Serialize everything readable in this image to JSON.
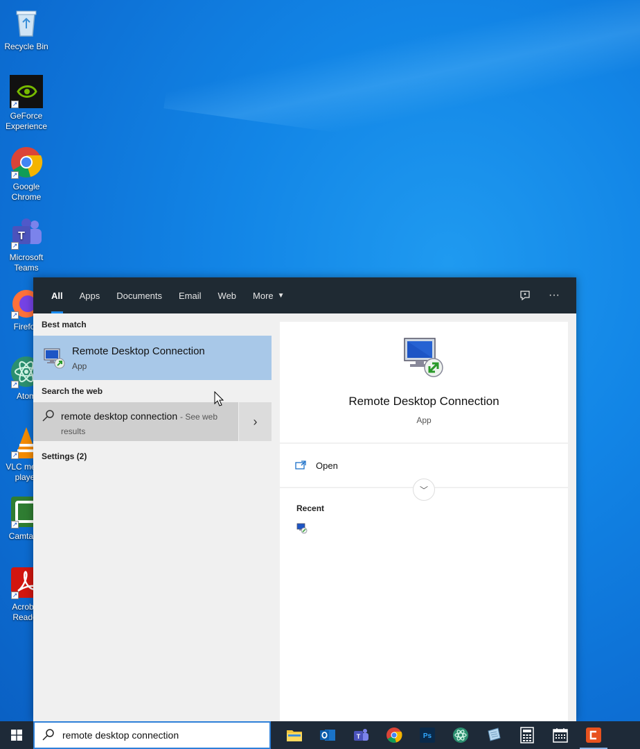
{
  "desktop": {
    "icons": [
      {
        "label": "Recycle Bin"
      },
      {
        "label": "GeForce Experience"
      },
      {
        "label": "Google Chrome"
      },
      {
        "label": "Microsoft Teams"
      },
      {
        "label": "Firefox"
      },
      {
        "label": "Atom"
      },
      {
        "label": "VLC media player"
      },
      {
        "label": "Camtasia"
      },
      {
        "label": "Acrobat Reader"
      }
    ]
  },
  "search_flyout": {
    "tabs": [
      "All",
      "Apps",
      "Documents",
      "Email",
      "Web",
      "More"
    ],
    "best_match_title": "Best match",
    "best_match": {
      "name": "Remote Desktop Connection",
      "type": "App"
    },
    "search_web_title": "Search the web",
    "web_result": {
      "query": "remote desktop connection",
      "hint": "- See web results"
    },
    "settings_title": "Settings (2)",
    "detail": {
      "name": "Remote Desktop Connection",
      "type": "App",
      "open_label": "Open",
      "recent_title": "Recent"
    }
  },
  "taskbar": {
    "search_value": "remote desktop connection",
    "apps": [
      "file-explorer",
      "outlook",
      "teams",
      "chrome",
      "photoshop",
      "atom",
      "notepad",
      "calculator",
      "calendar",
      "camtasia"
    ]
  },
  "colors": {
    "accent": "#1a8cf0",
    "selected_row": "#a8c8e8",
    "header_bg": "#1f2a33",
    "taskbar_bg": "#1e2a38"
  }
}
